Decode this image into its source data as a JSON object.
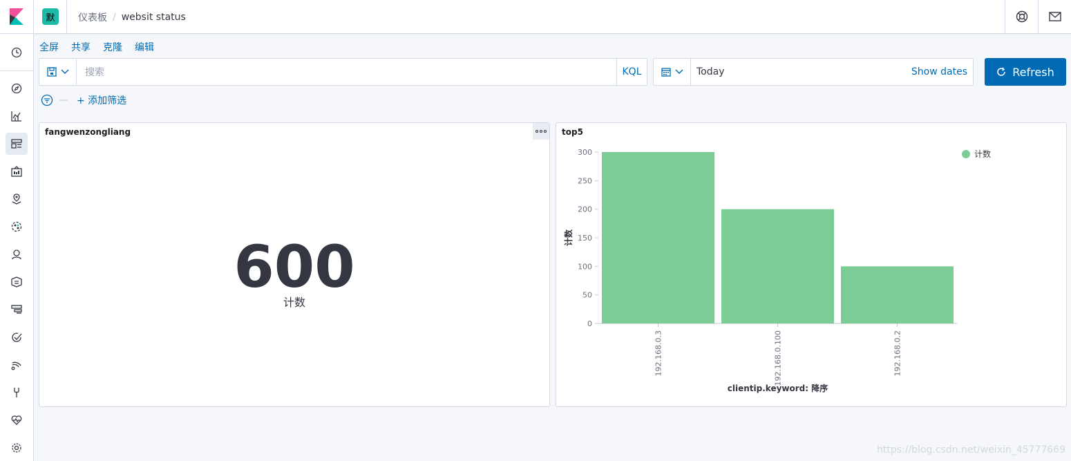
{
  "header": {
    "space_avatar": "默",
    "breadcrumb_root": "仪表板",
    "breadcrumb_current": "websit status",
    "right_icons": [
      "help-icon",
      "mail-icon"
    ]
  },
  "sidebar": {
    "items": [
      {
        "icon": "clock-icon",
        "active": false
      },
      {
        "icon": "compass-icon",
        "active": false
      },
      {
        "icon": "visualize-icon",
        "active": false
      },
      {
        "icon": "dashboard-icon",
        "active": true
      },
      {
        "icon": "canvas-icon",
        "active": false
      },
      {
        "icon": "maps-icon",
        "active": false
      },
      {
        "icon": "ml-icon",
        "active": false
      },
      {
        "icon": "infra-icon",
        "active": false
      },
      {
        "icon": "logs-icon",
        "active": false
      },
      {
        "icon": "apm-icon",
        "active": false
      },
      {
        "icon": "uptime-icon",
        "active": false
      },
      {
        "icon": "siem-icon",
        "active": false
      },
      {
        "icon": "devtools-icon",
        "active": false
      },
      {
        "icon": "monitoring-icon",
        "active": false
      },
      {
        "icon": "settings-icon",
        "active": false
      }
    ]
  },
  "menu": {
    "fullscreen": "全屏",
    "share": "共享",
    "clone": "克隆",
    "edit": "编辑"
  },
  "query": {
    "placeholder": "搜索",
    "language": "KQL"
  },
  "date": {
    "value": "Today",
    "show_dates": "Show dates"
  },
  "refresh_label": "Refresh",
  "filters": {
    "add_label": "+ 添加筛选"
  },
  "panels": {
    "metric": {
      "title": "fangwenzongliang",
      "value": "600",
      "label": "计数"
    },
    "chart": {
      "title": "top5"
    }
  },
  "chart_data": {
    "type": "bar",
    "title": "top5",
    "categories": [
      "192.168.0.3",
      "192.168.0.100",
      "192.168.0.2"
    ],
    "series": [
      {
        "name": "计数",
        "values": [
          300,
          200,
          100
        ],
        "color": "#7bcd95"
      }
    ],
    "xlabel": "clientip.keyword: 降序",
    "ylabel": "计数",
    "ylim": [
      0,
      300
    ],
    "yticks": [
      0,
      50,
      100,
      150,
      200,
      250,
      300
    ],
    "legend": "top-right",
    "grid": false
  },
  "watermark": "https://blog.csdn.net/weixin_45777669"
}
